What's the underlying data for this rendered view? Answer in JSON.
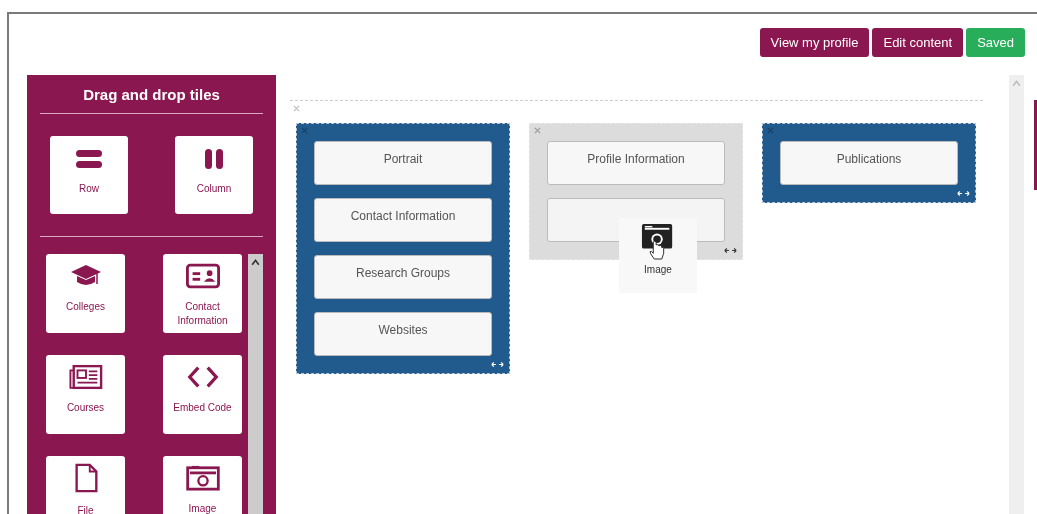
{
  "buttons": [
    {
      "label": "View my profile",
      "kind": "primary"
    },
    {
      "label": "Edit content",
      "kind": "primary"
    },
    {
      "label": "Saved",
      "kind": "success"
    }
  ],
  "sidebar": {
    "title": "Drag and drop tiles",
    "layout_tiles": [
      {
        "label": "Row",
        "kind": "row"
      },
      {
        "label": "Column",
        "kind": "column"
      }
    ],
    "content_tiles": [
      {
        "label": "Colleges",
        "kind": "colleges"
      },
      {
        "label": "Contact Information",
        "kind": "contact"
      },
      {
        "label": "Courses",
        "kind": "courses"
      },
      {
        "label": "Embed Code",
        "kind": "embed"
      },
      {
        "label": "File",
        "kind": "file"
      },
      {
        "label": "Image",
        "kind": "image"
      }
    ]
  },
  "canvas": {
    "columns": [
      {
        "drop_target": false,
        "tiles": [
          {
            "kind": "labelled",
            "label": "Portrait"
          },
          {
            "kind": "labelled",
            "label": "Contact Information"
          },
          {
            "kind": "labelled",
            "label": "Research Groups"
          },
          {
            "kind": "labelled",
            "label": "Websites"
          }
        ]
      },
      {
        "drop_target": true,
        "tiles": [
          {
            "kind": "labelled",
            "label": "Profile Information"
          },
          {
            "kind": "covered"
          }
        ]
      },
      {
        "drop_target": false,
        "tiles": [
          {
            "kind": "labelled",
            "label": "Publications"
          }
        ]
      }
    ]
  },
  "dragged_tile": {
    "label": "Image"
  }
}
